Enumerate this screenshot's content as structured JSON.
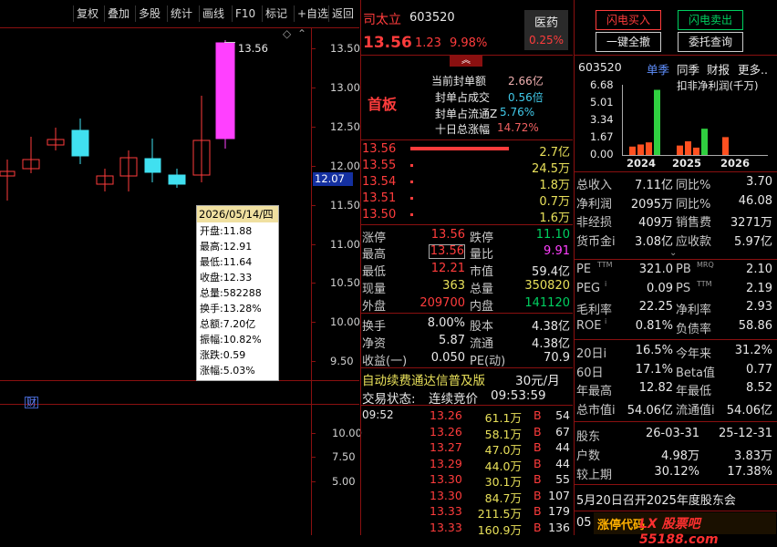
{
  "toolbar": {
    "items": [
      "复权",
      "叠加",
      "多股",
      "统计",
      "画线",
      "F10",
      "标记",
      "+自选",
      "返回"
    ]
  },
  "chart": {
    "y_labels": [
      "13.50",
      "13.00",
      "12.50",
      "12.00",
      "11.50",
      "11.00",
      "10.50",
      "10.00",
      "9.50"
    ],
    "lower_y_labels": [
      "10.00",
      "7.50",
      "5.00"
    ],
    "high_label": "13.56",
    "current_price_tag": "12.07",
    "fin_marker": "财",
    "tooltip": {
      "date": "2026/05/14/四",
      "rows": [
        "开盘:11.88",
        "最高:12.91",
        "最低:11.64",
        "收盘:12.33",
        "总量:582288",
        "换手:13.28%",
        "总额:7.20亿",
        "振幅:10.82%",
        "涨跌:0.59",
        "涨幅:5.03%"
      ]
    }
  },
  "stock": {
    "name": "司太立",
    "code": "603520",
    "sector": "医药",
    "sector_change": "0.25%",
    "price": "13.56",
    "change": "1.23",
    "change_pct": "9.98%",
    "board": "首板",
    "seal_stats": [
      {
        "label": "当前封单额",
        "value": "2.66亿"
      },
      {
        "label": "封单占成交",
        "value": "0.56倍"
      },
      {
        "label": "封单占流通Z",
        "value": "5.76%"
      },
      {
        "label": "十日总涨幅",
        "value": "14.72%"
      }
    ],
    "orders": [
      {
        "price": "13.56",
        "vol": "2.7亿"
      },
      {
        "price": "13.55",
        "vol": "24.5万"
      },
      {
        "price": "13.54",
        "vol": "1.8万"
      },
      {
        "price": "13.51",
        "vol": "0.7万"
      },
      {
        "price": "13.50",
        "vol": "1.6万"
      }
    ],
    "quote": [
      {
        "l1": "涨停",
        "v1": "13.56",
        "l2": "跌停",
        "v2": "11.10"
      },
      {
        "l1": "最高",
        "v1": "13.56",
        "l2": "量比",
        "v2": "9.91"
      },
      {
        "l1": "最低",
        "v1": "12.21",
        "l2": "市值",
        "v2": "59.4亿"
      },
      {
        "l1": "现量",
        "v1": "363",
        "l2": "总量",
        "v2": "350820"
      },
      {
        "l1": "外盘",
        "v1": "209700",
        "l2": "内盘",
        "v2": "141120"
      }
    ],
    "fundamentals": [
      {
        "l1": "换手",
        "v1": "8.00%",
        "l2": "股本",
        "v2": "4.38亿"
      },
      {
        "l1": "净资",
        "v1": "5.87",
        "l2": "流通",
        "v2": "4.38亿"
      },
      {
        "l1": "收益(一)",
        "v1": "0.050",
        "l2": "PE(动)",
        "v2": "70.9"
      }
    ],
    "promo": "自动续费通达信普及版",
    "promo_price": "30元/月",
    "trade_status_label": "交易状态:",
    "trade_status": "连续竞价",
    "trade_time": "09:53:59",
    "ticks_time": "09:52",
    "ticks": [
      {
        "price": "13.26",
        "vol": "61.1万",
        "side": "B",
        "n": "54"
      },
      {
        "price": "13.26",
        "vol": "58.1万",
        "side": "B",
        "n": "67"
      },
      {
        "price": "13.27",
        "vol": "47.0万",
        "side": "B",
        "n": "44"
      },
      {
        "price": "13.29",
        "vol": "44.0万",
        "side": "B",
        "n": "44"
      },
      {
        "price": "13.30",
        "vol": "30.1万",
        "side": "B",
        "n": "55"
      },
      {
        "price": "13.30",
        "vol": "84.7万",
        "side": "B",
        "n": "107"
      },
      {
        "price": "13.33",
        "vol": "211.5万",
        "side": "B",
        "n": "179"
      },
      {
        "price": "13.33",
        "vol": "160.9万",
        "side": "B",
        "n": "136"
      }
    ]
  },
  "actions": {
    "buy": "闪电买入",
    "sell": "闪电卖出",
    "cancel_all": "一键全撤",
    "order_query": "委托查询"
  },
  "right": {
    "code": "603520",
    "tabs": [
      "单季",
      "同季",
      "财报",
      "更多"
    ],
    "profit_label": "扣非净利润(千万)",
    "bar_y_labels": [
      "6.68",
      "5.01",
      "3.34",
      "1.67",
      "0.00"
    ],
    "bar_years": [
      "2024",
      "2025",
      "2026"
    ],
    "bar_chart_data": {
      "type": "bar",
      "categories": [
        "2024Q1",
        "2024Q2",
        "2024Q3",
        "2024Q4",
        "2025Q1",
        "2025Q2",
        "2025Q3",
        "2025Q4",
        "2026Q1"
      ],
      "values": [
        0.8,
        1.0,
        1.2,
        6.2,
        0.9,
        1.3,
        0.7,
        2.5,
        1.7
      ],
      "ylim": [
        0,
        6.68
      ]
    },
    "metrics": [
      {
        "l1": "总收入",
        "v1": "7.11亿",
        "l2": "同比%",
        "v2": "3.70"
      },
      {
        "l1": "净利润",
        "v1": "2095万",
        "l2": "同比%",
        "v2": "46.08"
      },
      {
        "l1": "非经损",
        "v1": "409万",
        "l2": "销售费",
        "v2": "3271万"
      },
      {
        "l1": "货币金i",
        "v1": "3.08亿",
        "l2": "应收款",
        "v2": "5.97亿"
      }
    ],
    "valuation": [
      {
        "l1": "PE",
        "s1": "TTM",
        "v1": "321.0",
        "l2": "PB",
        "s2": "MRQ",
        "v2": "2.10"
      },
      {
        "l1": "PEG",
        "s1": "i",
        "v1": "0.09",
        "l2": "PS",
        "s2": "TTM",
        "v2": "2.19"
      },
      {
        "l1": "毛利率",
        "s1": "",
        "v1": "22.25",
        "l2": "净利率",
        "s2": "",
        "v2": "2.93"
      },
      {
        "l1": "ROE",
        "s1": "i",
        "v1": "0.81%",
        "l2": "负债率",
        "s2": "",
        "v2": "58.86"
      }
    ],
    "perf": [
      {
        "l1": "20日i",
        "v1": "16.5%",
        "l2": "今年来",
        "v2": "31.2%"
      },
      {
        "l1": "60日",
        "v1": "17.1%",
        "l2": "Beta值",
        "v2": "0.77"
      },
      {
        "l1": "年最高",
        "v1": "12.82",
        "l2": "年最低",
        "v2": "8.52"
      },
      {
        "l1": "总市值i",
        "v1": "54.06亿",
        "l2": "流通值i",
        "v2": "54.06亿"
      }
    ],
    "holders": [
      {
        "l": "股东",
        "v1": "26-03-31",
        "v2": "25-12-31"
      },
      {
        "l": "户数",
        "v1": "4.98万",
        "v2": "3.83万"
      },
      {
        "l": "较上期",
        "v1": "30.12%",
        "v2": "17.38%"
      }
    ],
    "notice": "5月20日召开2025年度股东会",
    "footer_num": "05",
    "footer_text": "涨停代码",
    "watermark": "LX 股票吧 55188.com"
  }
}
